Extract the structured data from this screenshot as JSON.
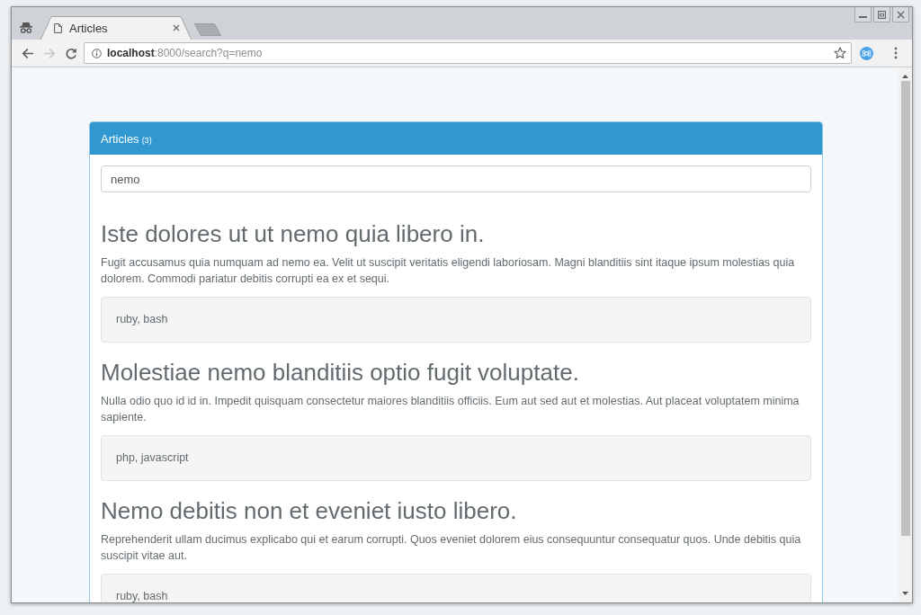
{
  "window": {
    "tabs": [
      {
        "label": "Articles",
        "selected": true
      }
    ]
  },
  "toolbar": {
    "nav_buttons": [
      {
        "kind": "back",
        "disabled": false
      },
      {
        "kind": "forward",
        "disabled": true
      },
      {
        "kind": "reload",
        "disabled": false
      }
    ],
    "url": "**localhost**:8000/search?q=nemo"
  },
  "panel": {
    "title": "Articles",
    "count": "(3)",
    "search": {
      "value": "nemo"
    },
    "articles": [
      {
        "title": "Iste dolores ut ut nemo quia libero in.",
        "summary": "Fugit accusamus quia numquam ad nemo ea. Velit ut suscipit veritatis eligendi laboriosam. Magni blanditiis sint itaque ipsum molestias quia dolorem. Commodi pariatur debitis corrupti ea ex et sequi.",
        "tags": "ruby, bash"
      },
      {
        "title": "Molestiae nemo blanditiis optio fugit voluptate.",
        "summary": "Nulla odio quo id id in. Impedit quisquam consectetur maiores blanditiis officiis. Eum aut sed aut et molestias. Aut placeat voluptatem minima sapiente.",
        "tags": "php, javascript"
      },
      {
        "title": "Nemo debitis non et eveniet iusto libero.",
        "summary": "Reprehenderit ullam ducimus explicabo qui et earum corrupti. Quos eveniet dolorem eius consequuntur consequatur quos. Unde debitis quia suscipit vitae aut.",
        "tags": "ruby, bash"
      }
    ]
  }
}
